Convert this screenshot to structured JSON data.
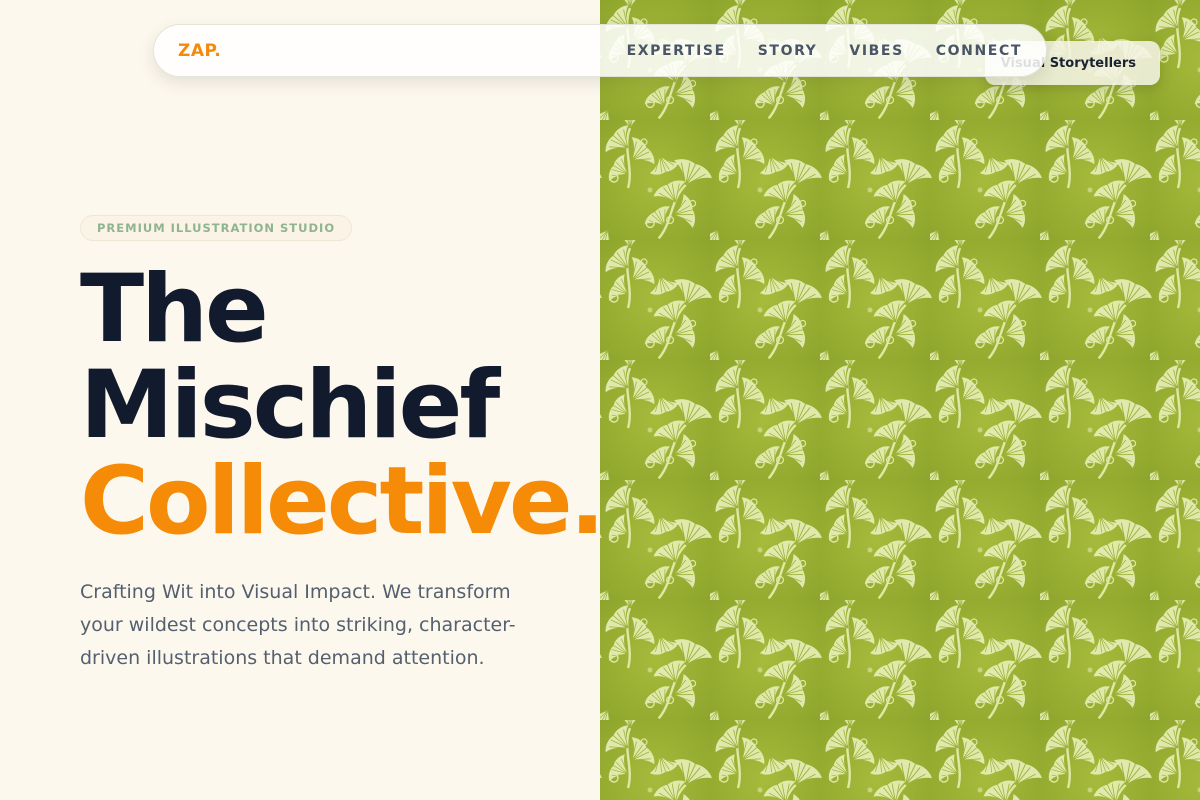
{
  "brand": {
    "logo": "ZAP."
  },
  "nav": {
    "links": [
      "EXPERTISE",
      "STORY",
      "VIBES",
      "CONNECT"
    ]
  },
  "badge": {
    "text": "Visual Storytellers"
  },
  "hero": {
    "eyebrow": "PREMIUM ILLUSTRATION STUDIO",
    "title_line1": "The",
    "title_line2": "Mischief",
    "title_line3": "Collective.",
    "description": "Crafting Wit into Visual Impact. We transform your wildest concepts into striking, character-driven illustrations that demand attention."
  },
  "colors": {
    "accent": "#f58b07",
    "heading": "#121a2e",
    "background": "#fdf8ee",
    "pattern_green": "#9bb134",
    "pattern_leaf": "#e8efb0"
  },
  "icons": {
    "pattern": "botanical-leaf-pattern"
  }
}
